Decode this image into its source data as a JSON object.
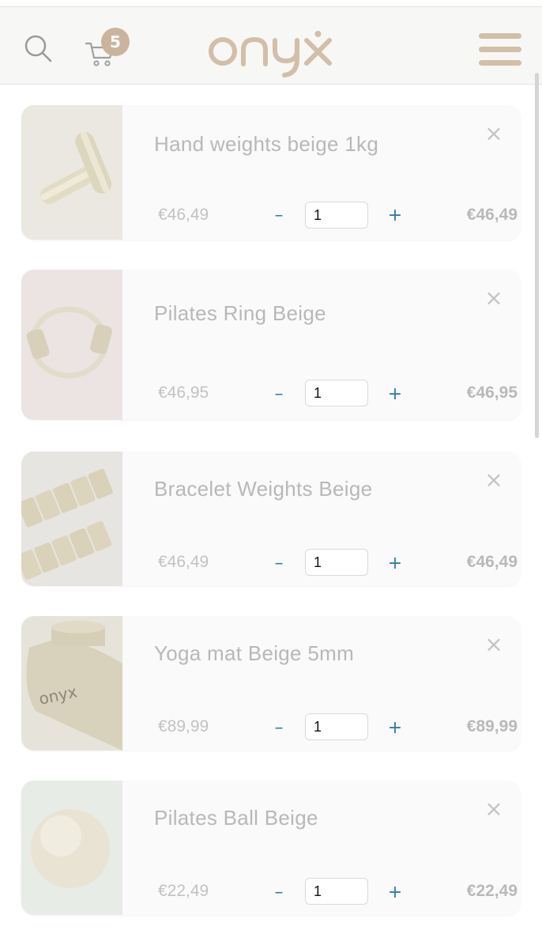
{
  "header": {
    "cart_count": "5",
    "logo_text": "onyx",
    "icons": [
      "search-icon",
      "cart-icon",
      "hamburger-menu-icon"
    ],
    "accent_color": "#cbb49d"
  },
  "cart": {
    "items": [
      {
        "title": "Hand weights beige 1kg",
        "unit_price": "€46,49",
        "quantity": "1",
        "total": "€46,49",
        "minus_label": "–",
        "plus_label": "+",
        "remove_label": "×"
      },
      {
        "title": "Pilates Ring Beige",
        "unit_price": "€46,95",
        "quantity": "1",
        "total": "€46,95",
        "minus_label": "–",
        "plus_label": "+",
        "remove_label": "×"
      },
      {
        "title": "Bracelet Weights Beige",
        "unit_price": "€46,49",
        "quantity": "1",
        "total": "€46,49",
        "minus_label": "–",
        "plus_label": "+",
        "remove_label": "×"
      },
      {
        "title": "Yoga mat Beige 5mm",
        "unit_price": "€89,99",
        "quantity": "1",
        "total": "€89,99",
        "minus_label": "–",
        "plus_label": "+",
        "remove_label": "×"
      },
      {
        "title": "Pilates Ball Beige",
        "unit_price": "€22,49",
        "quantity": "1",
        "total": "€22,49",
        "minus_label": "–",
        "plus_label": "+",
        "remove_label": "×"
      }
    ]
  }
}
